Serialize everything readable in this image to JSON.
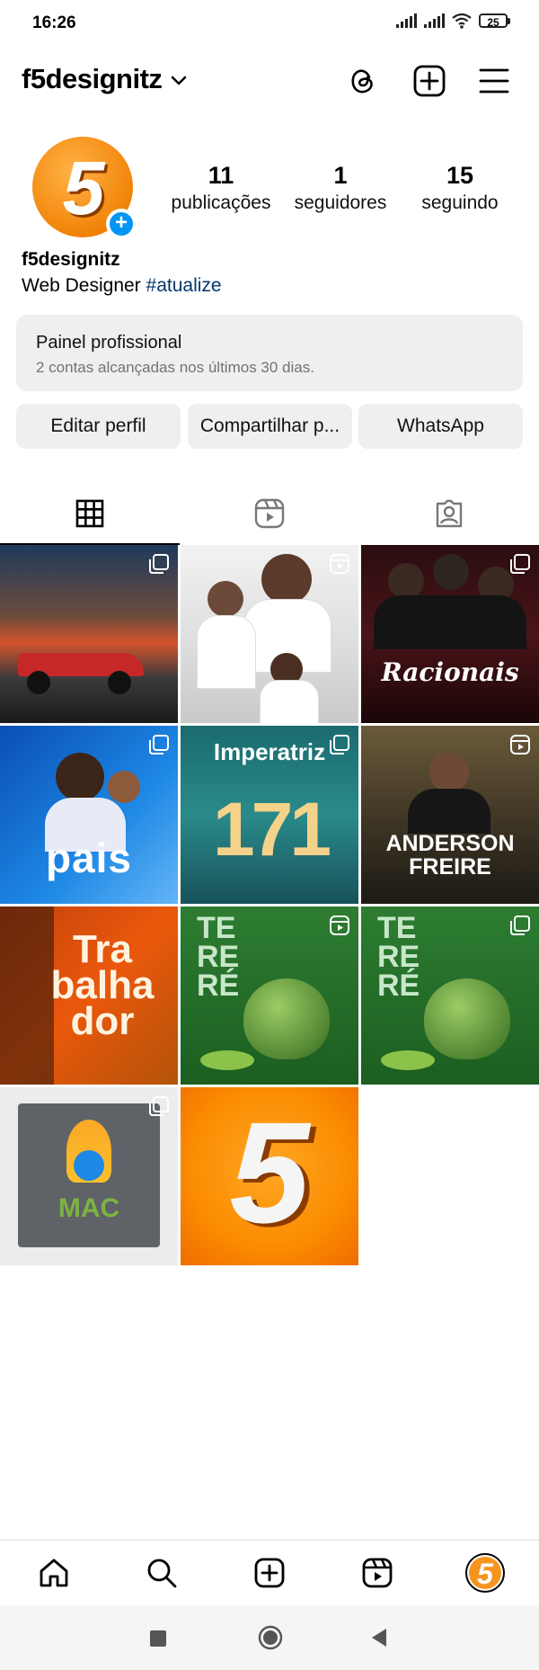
{
  "status_bar": {
    "time": "16:26",
    "battery": "25",
    "icons": [
      "signal-icon",
      "signal-icon",
      "wifi-icon",
      "battery-icon"
    ]
  },
  "header": {
    "username": "f5designitz",
    "icons": [
      "chevron-down-icon",
      "threads-icon",
      "add-post-icon",
      "menu-icon"
    ]
  },
  "profile": {
    "avatar_text": "5",
    "stats": [
      {
        "value": "11",
        "label": "publicações"
      },
      {
        "value": "1",
        "label": "seguidores"
      },
      {
        "value": "15",
        "label": "seguindo"
      }
    ],
    "name": "f5designitz",
    "bio_prefix": "Web Designer ",
    "bio_tag": "#atualize"
  },
  "pro_panel": {
    "title": "Painel profissional",
    "subtitle": "2 contas alcançadas nos últimos 30 dias."
  },
  "buttons": {
    "edit": "Editar perfil",
    "share": "Compartilhar p...",
    "whatsapp": "WhatsApp"
  },
  "tabs": [
    "grid-icon",
    "reels-icon",
    "tagged-icon"
  ],
  "posts": [
    {
      "name": "post-formula1",
      "badge": "carousel",
      "text": ""
    },
    {
      "name": "post-football",
      "badge": "reel",
      "text": ""
    },
    {
      "name": "post-racionais",
      "badge": "carousel",
      "text": "Racionais"
    },
    {
      "name": "post-dia-dos-pais",
      "badge": "carousel",
      "text": "pais"
    },
    {
      "name": "post-imperatriz",
      "badge": "carousel",
      "text": "Imperatriz"
    },
    {
      "name": "post-anderson-freire",
      "badge": "reel",
      "text": "ANDERSON FREIRE"
    },
    {
      "name": "post-trabalhador",
      "badge": "",
      "text": "Tra balha dor"
    },
    {
      "name": "post-terere-1",
      "badge": "reel",
      "text": "TE RE RÉ"
    },
    {
      "name": "post-terere-2",
      "badge": "carousel",
      "text": "TE RE RÉ"
    },
    {
      "name": "post-mac",
      "badge": "carousel",
      "text": "MAC"
    },
    {
      "name": "post-logo",
      "badge": "",
      "text": "5"
    }
  ],
  "colors": {
    "accent_blue": "#0095f6",
    "link_blue": "#00376b",
    "brand_orange": "#f7941d",
    "panel_gray": "#efefef"
  },
  "bottom_nav": [
    "home-icon",
    "search-icon",
    "create-icon",
    "reels-icon",
    "profile-avatar"
  ],
  "system_nav": [
    "recents-icon",
    "home-button-icon",
    "back-icon"
  ]
}
